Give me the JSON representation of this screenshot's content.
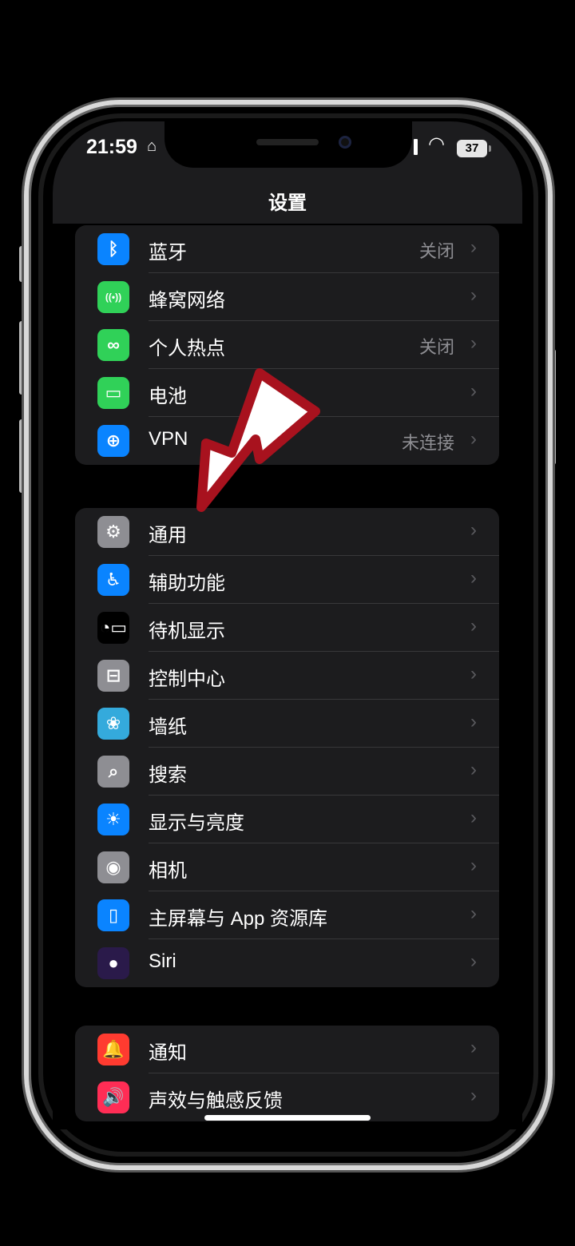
{
  "status": {
    "time": "21:59",
    "battery": "37"
  },
  "nav": {
    "title": "设置"
  },
  "group1": [
    {
      "label": "蓝牙",
      "value": "关闭",
      "icon": "bluetooth-icon",
      "color": "#0a84ff",
      "glyph": "ᛒ"
    },
    {
      "label": "蜂窝网络",
      "value": "",
      "icon": "cellular-icon",
      "color": "#30d158",
      "glyph": "((•))"
    },
    {
      "label": "个人热点",
      "value": "关闭",
      "icon": "hotspot-icon",
      "color": "#30d158",
      "glyph": "∞"
    },
    {
      "label": "电池",
      "value": "",
      "icon": "battery-icon",
      "color": "#30d158",
      "glyph": "▭"
    },
    {
      "label": "VPN",
      "value": "未连接",
      "icon": "vpn-icon",
      "color": "#0a84ff",
      "glyph": "⊕"
    }
  ],
  "group2": [
    {
      "label": "通用",
      "icon": "gear-icon",
      "color": "#8e8e93",
      "glyph": "⚙"
    },
    {
      "label": "辅助功能",
      "icon": "accessibility-icon",
      "color": "#0a84ff",
      "glyph": "♿"
    },
    {
      "label": "待机显示",
      "icon": "standby-icon",
      "color": "#000000",
      "glyph": "◔▭"
    },
    {
      "label": "控制中心",
      "icon": "control-center-icon",
      "color": "#8e8e93",
      "glyph": "⊟"
    },
    {
      "label": "墙纸",
      "icon": "wallpaper-icon",
      "color": "#34aadc",
      "glyph": "❀"
    },
    {
      "label": "搜索",
      "icon": "search-icon",
      "color": "#8e8e93",
      "glyph": "⌕"
    },
    {
      "label": "显示与亮度",
      "icon": "brightness-icon",
      "color": "#0a84ff",
      "glyph": "☀"
    },
    {
      "label": "相机",
      "icon": "camera-icon",
      "color": "#8e8e93",
      "glyph": "◉"
    },
    {
      "label": "主屏幕与 App 资源库",
      "icon": "home-screen-icon",
      "color": "#0a84ff",
      "glyph": "▯"
    },
    {
      "label": "Siri",
      "icon": "siri-icon",
      "color": "#2a1a4a",
      "glyph": "●"
    }
  ],
  "group3": [
    {
      "label": "通知",
      "icon": "notification-icon",
      "color": "#ff3b30",
      "glyph": "🔔"
    },
    {
      "label": "声效与触感反馈",
      "icon": "sound-icon",
      "color": "#ff2d55",
      "glyph": "🔊"
    }
  ],
  "chevron": "›"
}
